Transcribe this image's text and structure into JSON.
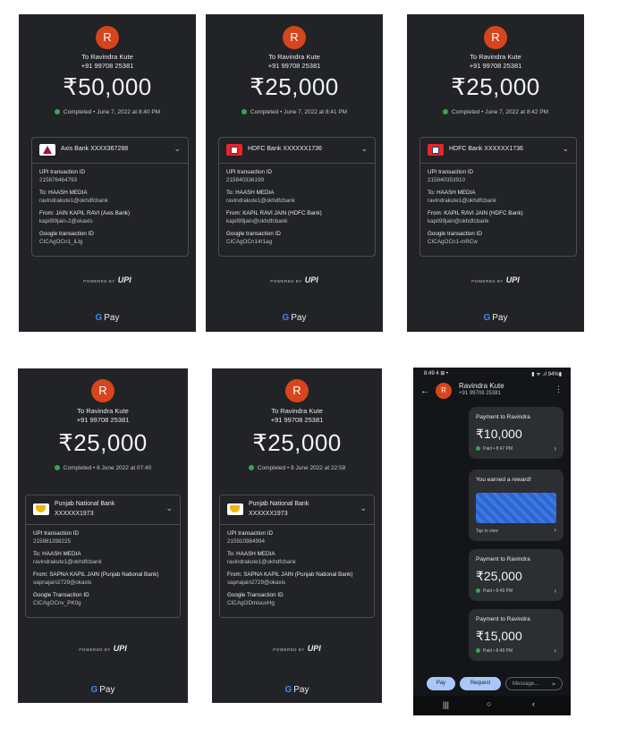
{
  "receipts": [
    {
      "avatar": "R",
      "to_name": "To Ravindra Kute",
      "to_phone": "+91 99708 25381",
      "amount": "₹50,000",
      "status": "Completed • June 7, 2022 at 8:40 PM",
      "bank": "Axis Bank XXXX367288",
      "bank_line2": "",
      "rows": [
        {
          "label": "UPI transaction ID",
          "value": "215876464793"
        },
        {
          "label": "To: HAASH MEDIA",
          "value": "ravindrakute1@okhdfcbank"
        },
        {
          "label": "From: JAIN KAPIL RAVI (Axis Bank)",
          "value": "kapil99jain-2@okaxis"
        },
        {
          "label": "Google transaction ID",
          "value": "CICAgOCn1_iLlg"
        }
      ]
    },
    {
      "avatar": "R",
      "to_name": "To Ravindra Kute",
      "to_phone": "+91 99708 25381",
      "amount": "₹25,000",
      "status": "Completed • June 7, 2022 at 8:41 PM",
      "bank": "HDFC Bank XXXXXX1736",
      "bank_line2": "",
      "rows": [
        {
          "label": "UPI transaction ID",
          "value": "215840336199"
        },
        {
          "label": "To: HAASH MEDIA",
          "value": "ravindrakute1@okhdfcbank"
        },
        {
          "label": "From: KAPIL RAVI JAIN (HDFC Bank)",
          "value": "kapil99jain@okhdfcbank"
        },
        {
          "label": "Google transaction ID",
          "value": "CICAgOCn14r1ag"
        }
      ]
    },
    {
      "avatar": "R",
      "to_name": "To Ravindra Kute",
      "to_phone": "+91 99708 25381",
      "amount": "₹25,000",
      "status": "Completed • June 7, 2022 at 8:42 PM",
      "bank": "HDFC Bank XXXXXX1736",
      "bank_line2": "",
      "rows": [
        {
          "label": "UPI transaction ID",
          "value": "215840353910"
        },
        {
          "label": "To: HAASH MEDIA",
          "value": "ravindrakute1@okhdfcbank"
        },
        {
          "label": "From: KAPIL RAVI JAIN (HDFC Bank)",
          "value": "kapil99jain@okhdfcbank"
        },
        {
          "label": "Google transaction ID",
          "value": "CICAgOCn1-mRCw"
        }
      ]
    },
    {
      "avatar": "R",
      "to_name": "To Ravindra Kute",
      "to_phone": "+91 99708 25381",
      "amount": "₹25,000",
      "status": "Completed • 8 June 2022 at 07:40",
      "bank": "Punjab National Bank",
      "bank_line2": "XXXXXX1973",
      "rows": [
        {
          "label": "UPI transaction ID",
          "value": "215981398225"
        },
        {
          "label": "To: HAASH MEDIA",
          "value": "ravindrakute1@okhdfcbank"
        },
        {
          "label": "From: SAPNA KAPIL JAIN (Punjab National Bank)",
          "value": "sapnajain2729@okaxis"
        },
        {
          "label": "Google Transaction ID",
          "value": "CICAgOCnv_PK0g"
        }
      ]
    },
    {
      "avatar": "R",
      "to_name": "To Ravindra Kute",
      "to_phone": "+91 99708 25381",
      "amount": "₹25,000",
      "status": "Completed • 8 June 2022 at 22:58",
      "bank": "Punjab National Bank",
      "bank_line2": "XXXXXX1973",
      "rows": [
        {
          "label": "UPI transaction ID",
          "value": "215910984994"
        },
        {
          "label": "To: HAASH MEDIA",
          "value": "ravindrakute1@okhdfcbank"
        },
        {
          "label": "From: SAPNA KAPIL JAIN (Punjab National Bank)",
          "value": "sapnajain2729@okaxis"
        },
        {
          "label": "Google Transaction ID",
          "value": "CICAgODmiuuxHg"
        }
      ]
    }
  ],
  "footer": {
    "powered_by": "POWERED BY",
    "upi": "UPI",
    "gpay_g": "G",
    "gpay_text": "Pay"
  },
  "chat": {
    "status_time": "8:49",
    "status_icons": "4 ⊞ •",
    "status_right": "▮ ᯤ .ıl 94%▮",
    "name": "Ravindra Kute",
    "phone": "+91 99708 25381",
    "avatar": "R",
    "messages": [
      {
        "title": "Payment to Ravindra",
        "amount": "₹10,000",
        "paid": "Paid • 8:47 PM"
      },
      {
        "title": "You earned a reward!",
        "tap": "Tap to view"
      },
      {
        "title": "Payment to Ravindra",
        "amount": "₹25,000",
        "paid": "Paid • 8:49 PM"
      },
      {
        "title": "Payment to Ravindra",
        "amount": "₹15,000",
        "paid": "Paid • 8:49 PM"
      }
    ],
    "pay_label": "Pay",
    "request_label": "Request",
    "message_placeholder": "Message..."
  },
  "colors": {
    "background": "#222326",
    "avatar": "#d6451c",
    "success": "#34a853",
    "accent": "#a8c7fa"
  }
}
